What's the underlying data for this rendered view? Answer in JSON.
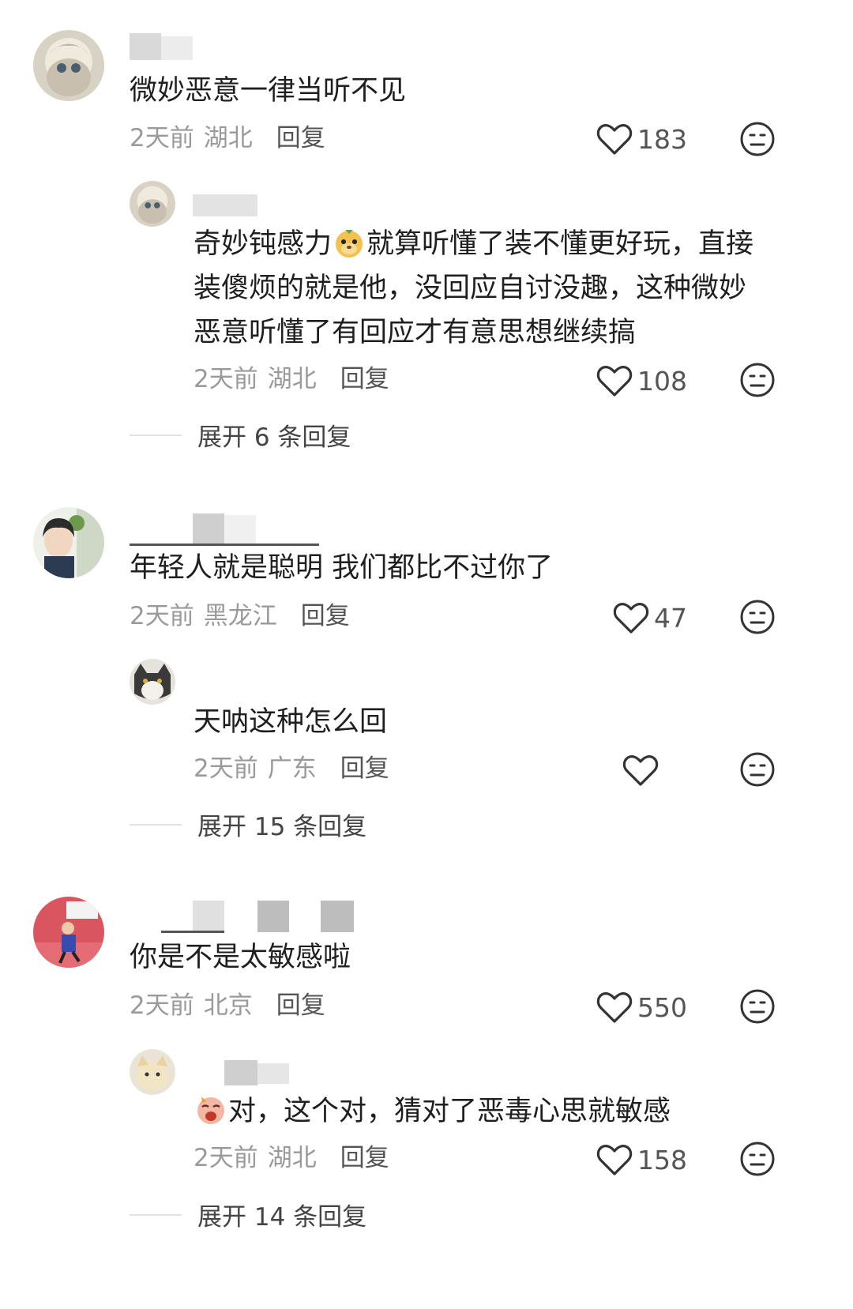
{
  "comments": [
    {
      "text": "微妙恶意一律当听不见",
      "time": "2天前",
      "location": "湖北",
      "reply_label": "回复",
      "likes": "183",
      "reply": {
        "lines": [
          "就算听懂了装不懂更好玩，直接",
          "装傻烦的就是他，没回应自讨没趣，这种微妙",
          "恶意听懂了有回应才有意思想继续搞"
        ],
        "line1_prefix": "奇妙钝感力",
        "time": "2天前",
        "location": "湖北",
        "reply_label": "回复",
        "likes": "108"
      },
      "expand": "展开 6 条回复"
    },
    {
      "text": "年轻人就是聪明 我们都比不过你了",
      "time": "2天前",
      "location": "黑龙江",
      "reply_label": "回复",
      "likes": "47",
      "reply": {
        "text": "天呐这种怎么回",
        "time": "2天前",
        "location": "广东",
        "reply_label": "回复",
        "likes": ""
      },
      "expand": "展开 15 条回复"
    },
    {
      "text": "你是不是太敏感啦",
      "time": "2天前",
      "location": "北京",
      "reply_label": "回复",
      "likes": "550",
      "reply": {
        "text": "对，这个对，猜对了恶毒心思就敏感",
        "time": "2天前",
        "location": "湖北",
        "reply_label": "回复",
        "likes": "158"
      },
      "expand": "展开 14 条回复"
    }
  ],
  "colors": {
    "text": "#1f1f1f",
    "meta": "#9a9a9a",
    "reply_link": "#555555",
    "icon_stroke": "#333333",
    "redaction": "#d9d9d9"
  },
  "icons": [
    "heart-outline-icon",
    "neutral-face-icon",
    "doge-emoji",
    "crying-emoji"
  ]
}
